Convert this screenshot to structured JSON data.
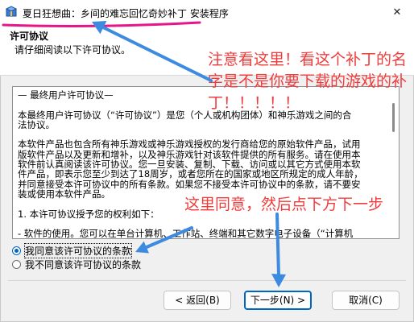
{
  "window": {
    "title": "夏日狂想曲：乡间的难忘回忆奇妙补丁 安装程序",
    "icon": "installer-icon",
    "close_icon": "close-icon",
    "close_glyph": "✕"
  },
  "header": {
    "title": "许可协议",
    "subtitle": "请仔细阅读以下许可协议。"
  },
  "license": {
    "lines": [
      "— 最终用户许可协议—",
      "",
      "本最终用户许可协议（“许可协议”）是您（个人或机构团体）和神乐游戏之间的合",
      "法协议。",
      "",
      "本软件产品也包含所有神乐游戏或神乐游戏授权的发行商给您的原始软件产品，试用",
      "版软件产品以及更新和增补，以及神乐游戏针对该软件提供的所有服务。请在使用本",
      "软件前认真阅读该许可协议。您一旦安装、复制、下载、访问或以其它方式使用本软",
      "件产品，即表示您至少到达了18周岁，或者您所在的国家或地区所规定的成人年龄，",
      "并同意接受本许可协议中的所有条款。如果您不接受本许可协议中的条款，请不要安",
      "装或使用本软件产品。",
      "",
      "1. 本许可协议授予您的权利如下：",
      "",
      "- 软件的使用。您可以在单台计算机、工作站、终端和其它数字电子设备（“计算机"
    ]
  },
  "options": [
    {
      "label": "我同意该许可协议的条款",
      "selected": true
    },
    {
      "label": "我不同意该许可协议的条款",
      "selected": false
    }
  ],
  "buttons": {
    "back": "< 返回(B)",
    "next": "下一步(N) >",
    "cancel": "取消(C)"
  },
  "annotations": {
    "top_note_lines": [
      "注意看这里！看这个补丁的名",
      "字是不是你要下载的游戏的补",
      "丁！！！！！"
    ],
    "bottom_note": "这里同意，然后点下方下一步"
  },
  "colors": {
    "accent": "#0067c0",
    "annotation_red": "#f03c3c",
    "arrow_blue": "#3d8be0",
    "underline_pink": "#e6158a"
  }
}
